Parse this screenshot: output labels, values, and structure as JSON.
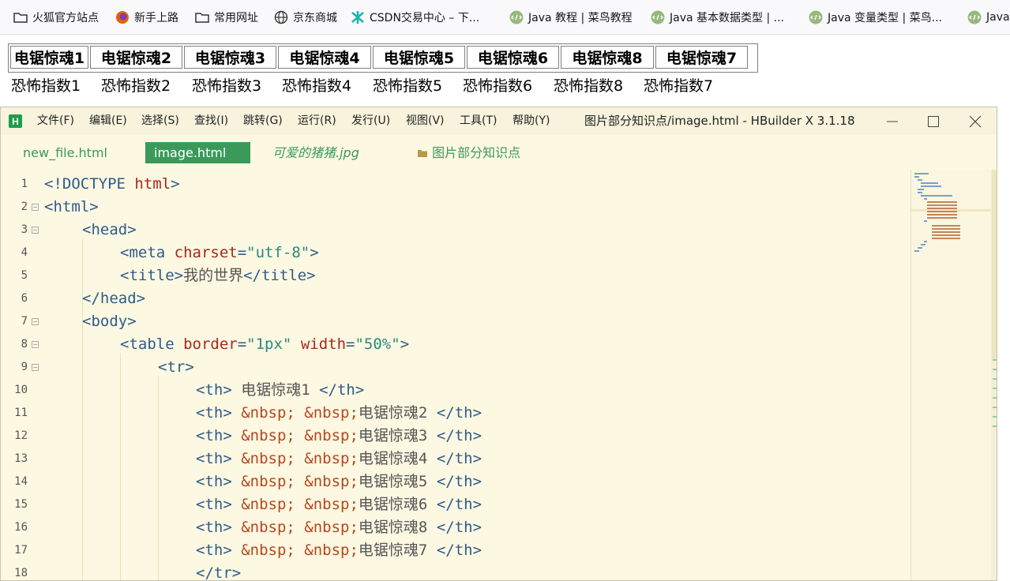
{
  "bookmarks": [
    {
      "label": "火狐官方站点",
      "icon": "folder-icon"
    },
    {
      "label": "新手上路",
      "icon": "firefox-icon"
    },
    {
      "label": "常用网址",
      "icon": "folder-icon"
    },
    {
      "label": "京东商城",
      "icon": "globe-icon"
    },
    {
      "label": "CSDN交易中心 – 下...",
      "icon": "csdn-icon"
    },
    {
      "label": "Java 教程 | 菜鸟教程",
      "icon": "runoob-icon"
    },
    {
      "label": "Java 基本数据类型 | ...",
      "icon": "runoob-icon"
    },
    {
      "label": "Java 变量类型 | 菜鸟...",
      "icon": "runoob-icon"
    },
    {
      "label": "Java",
      "icon": "runoob-icon"
    }
  ],
  "rendered_page": {
    "headers": [
      "电锯惊魂1",
      "电锯惊魂2",
      "电锯惊魂3",
      "电锯惊魂4",
      "电锯惊魂5",
      "电锯惊魂6",
      "电锯惊魂8",
      "电锯惊魂7"
    ],
    "row2": [
      "恐怖指数1",
      "恐怖指数2",
      "恐怖指数3",
      "恐怖指数4",
      "恐怖指数5",
      "恐怖指数6",
      "恐怖指数8",
      "恐怖指数7"
    ]
  },
  "editor": {
    "app_icon": "H",
    "menu": [
      "文件(F)",
      "编辑(E)",
      "选择(S)",
      "查找(I)",
      "跳转(G)",
      "运行(R)",
      "发行(U)",
      "视图(V)",
      "工具(T)",
      "帮助(Y)"
    ],
    "window_title": "图片部分知识点/image.html - HBuilder X 3.1.18",
    "tabs": {
      "file1": "new_file.html",
      "file2": "image.html",
      "file3": "可爱的猪猪.jpg",
      "folder": "图片部分知识点"
    },
    "line_numbers": [
      "1",
      "2",
      "3",
      "4",
      "5",
      "6",
      "7",
      "8",
      "9",
      "10",
      "11",
      "12",
      "13",
      "14",
      "15",
      "16",
      "17",
      "18"
    ],
    "code": {
      "l1": {
        "open": "<!DOCTYPE ",
        "kw": "html",
        "close": ">"
      },
      "l2": "<html>",
      "l3": "<head>",
      "l4": {
        "open": "<meta ",
        "attr": "charset",
        "eq": "=",
        "val": "\"utf-8\"",
        "close": ">"
      },
      "l5": {
        "open": "<title>",
        "text": "我的世界",
        "close": "</title>"
      },
      "l6": "</head>",
      "l7": "<body>",
      "l8": {
        "open": "<table ",
        "a1": "border",
        "eq1": "=",
        "v1": "\"1px\"",
        "sp": " ",
        "a2": "width",
        "eq2": "=",
        "v2": "\"50%\"",
        "close": ">"
      },
      "l9": "<tr>",
      "l10": {
        "open": "<th>",
        "text": " 电锯惊魂1 ",
        "close": "</th>"
      },
      "th_open": "<th>",
      "th_close": "</th>",
      "nbsp": " &nbsp; &nbsp;",
      "l11": "电锯惊魂2 ",
      "l12": "电锯惊魂3 ",
      "l13": "电锯惊魂4 ",
      "l14": "电锯惊魂5 ",
      "l15": "电锯惊魂6 ",
      "l16": "电锯惊魂8 ",
      "l17": "电锯惊魂7 ",
      "l18": "</tr>"
    }
  },
  "colors": {
    "editor_bg": "#fdf8e2",
    "active_tab": "#3b9a5a",
    "tab_text": "#3b9a5a",
    "tag": "#2e5c8a",
    "attribute": "#a6281a",
    "string": "#2a8a7d"
  }
}
